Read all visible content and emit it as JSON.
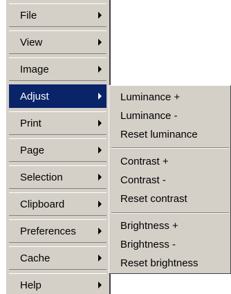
{
  "main_menu": {
    "items": [
      {
        "label": "File"
      },
      {
        "label": "View"
      },
      {
        "label": "Image"
      },
      {
        "label": "Adjust"
      },
      {
        "label": "Print"
      },
      {
        "label": "Page"
      },
      {
        "label": "Selection"
      },
      {
        "label": "Clipboard"
      },
      {
        "label": "Preferences"
      },
      {
        "label": "Cache"
      },
      {
        "label": "Help"
      }
    ],
    "active_item": "Adjust"
  },
  "adjust_submenu": {
    "groups": [
      {
        "items": [
          {
            "label": "Luminance +"
          },
          {
            "label": "Luminance -"
          },
          {
            "label": "Reset luminance"
          }
        ]
      },
      {
        "items": [
          {
            "label": "Contrast +"
          },
          {
            "label": "Contrast -"
          },
          {
            "label": "Reset contrast"
          }
        ]
      },
      {
        "items": [
          {
            "label": "Brightness +"
          },
          {
            "label": "Brightness -"
          },
          {
            "label": "Reset brightness"
          }
        ]
      }
    ]
  },
  "colors": {
    "menu_face": "#d4d0c8",
    "highlight": "#0a246a",
    "highlight_text": "#ffffff",
    "shadow": "#808080"
  }
}
